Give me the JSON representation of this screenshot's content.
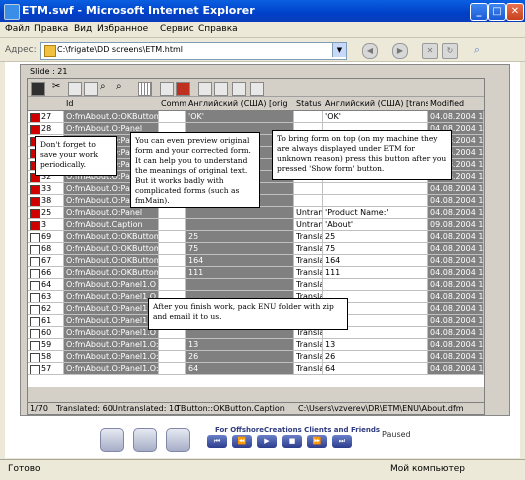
{
  "window": {
    "title": "ETM.swf - Microsoft Internet Explorer"
  },
  "menu": [
    "Файл",
    "Правка",
    "Вид",
    "Избранное",
    "Сервис",
    "Справка"
  ],
  "address": {
    "label": "Адрес:",
    "value": "C:\\frigate\\DD screens\\ETM.html"
  },
  "slide": "Slide : 21",
  "grid": {
    "columns": [
      "Id",
      "Comme",
      "Английский (США) [orig",
      "Status",
      "Английский (США) [translate",
      "Modified"
    ],
    "rows": [
      {
        "mark": "red",
        "num": "27",
        "id": "O:fmAbout.O:OKButton.Ca",
        "com": "",
        "eng": "'OK'",
        "st": "",
        "us": "'OK'",
        "mod": "04.08.2004 16:"
      },
      {
        "mark": "red",
        "num": "28",
        "id": "O:fmAbout.O:Panel",
        "com": "",
        "eng": "",
        "st": "",
        "us": "",
        "mod": "04.08.2004 16:"
      },
      {
        "mark": "red",
        "num": "29",
        "id": "O:fmAbout.O:Panel",
        "com": "",
        "eng": "",
        "st": "",
        "us": "",
        "mod": "04.08.2004 16:"
      },
      {
        "mark": "red",
        "num": "30",
        "id": "O:fmAbout.O:Panel",
        "com": "",
        "eng": "",
        "st": "",
        "us": "",
        "mod": "04.08.2004 16:"
      },
      {
        "mark": "red",
        "num": "31",
        "id": "O:fmAbout.O:Panel",
        "com": "",
        "eng": "",
        "st": "",
        "us": "",
        "mod": "04.08.2004 16:"
      },
      {
        "mark": "red",
        "num": "32",
        "id": "O:fmAbout.O:Panel",
        "com": "",
        "eng": "",
        "st": "",
        "us": "",
        "mod": "04.08.2004 16:"
      },
      {
        "mark": "red",
        "num": "33",
        "id": "O:fmAbout.O:Panel",
        "com": "",
        "eng": "",
        "st": "",
        "us": "",
        "mod": "04.08.2004 16:"
      },
      {
        "mark": "red",
        "num": "38",
        "id": "O:fmAbout.O:Panel",
        "com": "",
        "eng": "",
        "st": "",
        "us": "",
        "mod": "04.08.2004 16:"
      },
      {
        "mark": "red",
        "num": "25",
        "id": "O:fmAbout.O:Panel",
        "com": "",
        "eng": "",
        "st": "Untrans",
        "us": "'Product Name:'",
        "mod": "04.08.2004 16:"
      },
      {
        "mark": "red",
        "num": "3",
        "id": "O:fmAbout.Caption",
        "com": "",
        "eng": "",
        "st": "Untrans",
        "us": "'About'",
        "mod": "09.08.2004 14:"
      },
      {
        "mark": "white",
        "num": "69",
        "id": "O:fmAbout.O:OKButton.Wi",
        "com": "",
        "eng": "25",
        "st": "Transla",
        "us": "25",
        "mod": "04.08.2004 16:"
      },
      {
        "mark": "white",
        "num": "68",
        "id": "O:fmAbout.O:OKButton.Wi",
        "com": "",
        "eng": "75",
        "st": "Transla",
        "us": "75",
        "mod": "04.08.2004 16:"
      },
      {
        "mark": "white",
        "num": "67",
        "id": "O:fmAbout.O:OKButton.To",
        "com": "",
        "eng": "164",
        "st": "Transla",
        "us": "164",
        "mod": "04.08.2004 16:"
      },
      {
        "mark": "white",
        "num": "66",
        "id": "O:fmAbout.O:OKButton.Le",
        "com": "",
        "eng": "111",
        "st": "Transla",
        "us": "111",
        "mod": "04.08.2004 16:"
      },
      {
        "mark": "white",
        "num": "64",
        "id": "O:fmAbout.O:Panel1.O",
        "com": "",
        "eng": "",
        "st": "Transla",
        "us": "",
        "mod": "04.08.2004 16:"
      },
      {
        "mark": "white",
        "num": "63",
        "id": "O:fmAbout.O:Panel1.O",
        "com": "",
        "eng": "",
        "st": "Transla",
        "us": "",
        "mod": "04.08.2004 16:"
      },
      {
        "mark": "white",
        "num": "62",
        "id": "O:fmAbout.O:Panel1.O",
        "com": "",
        "eng": "",
        "st": "Transla",
        "us": "",
        "mod": "04.08.2004 16:"
      },
      {
        "mark": "white",
        "num": "61",
        "id": "O:fmAbout.O:Panel1.O",
        "com": "",
        "eng": "",
        "st": "Transla",
        "us": "",
        "mod": "04.08.2004 16:"
      },
      {
        "mark": "white",
        "num": "60",
        "id": "O:fmAbout.O:Panel1.O",
        "com": "",
        "eng": "",
        "st": "Transla",
        "us": "",
        "mod": "04.08.2004 16:"
      },
      {
        "mark": "white",
        "num": "59",
        "id": "O:fmAbout.O:Panel1.O:Lab",
        "com": "",
        "eng": "13",
        "st": "Transla",
        "us": "13",
        "mod": "04.08.2004 16:"
      },
      {
        "mark": "white",
        "num": "58",
        "id": "O:fmAbout.O:Panel1.O:Lab",
        "com": "",
        "eng": "26",
        "st": "Transla",
        "us": "26",
        "mod": "04.08.2004 16:"
      },
      {
        "mark": "white",
        "num": "57",
        "id": "O:fmAbout.O:Panel1.O:Lab",
        "com": "",
        "eng": "64",
        "st": "Transla",
        "us": "64",
        "mod": "04.08.2004 16:"
      }
    ]
  },
  "status": {
    "pos": "1/70",
    "translated": "Translated: 60",
    "untranslated": "Untranslated: 10",
    "item": "TButton::OKButton.Caption",
    "path": "C:\\Users\\vzverev\\DR\\ETM\\ENU\\About.dfm"
  },
  "callouts": {
    "save": "Don't forget to save your work periodically.",
    "preview": "You can even preview original form and your corrected form. It can help you to understand the meanings of original text. But it works badly with complicated forms (such as fmMain).",
    "ontop": "To bring form on top (on my machine they are always displayed under ETM for unknown reason) press this button after you pressed 'Show form' button.",
    "pack": "After you finish work, pack ENU folder with zip and email it to us."
  },
  "player": {
    "label": "For OffshoreCreations Clients and Friends",
    "state": "Paused"
  },
  "iestatus": {
    "left": "Готово",
    "right": "Мой компьютер"
  }
}
